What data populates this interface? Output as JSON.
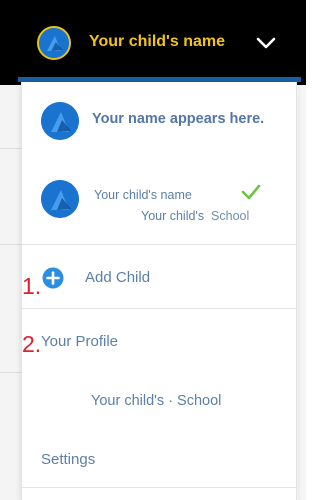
{
  "header": {
    "child_name": "Your child's name",
    "avatar_icon": "avatar-icon",
    "chevron_icon": "chevron-down-icon",
    "accent_color": "#f2c31a",
    "bar_color": "#000000",
    "stripe_color": "#1b5ea6"
  },
  "menu": {
    "user_name": "Your name appears here.",
    "child": {
      "name": "Your child's name",
      "school_prefix": "Your child's",
      "school_word": "School",
      "selected_icon": "check-icon"
    },
    "add_child": {
      "label": "Add Child",
      "icon": "plus-circle-icon"
    },
    "your_profile_label": "Your Profile",
    "profile_school": "Your child's  · School",
    "settings_label": "Settings",
    "text_color": "#5c7fa8"
  },
  "annotations": {
    "step1": "1.",
    "step2": "2.",
    "color": "#e0202a"
  }
}
